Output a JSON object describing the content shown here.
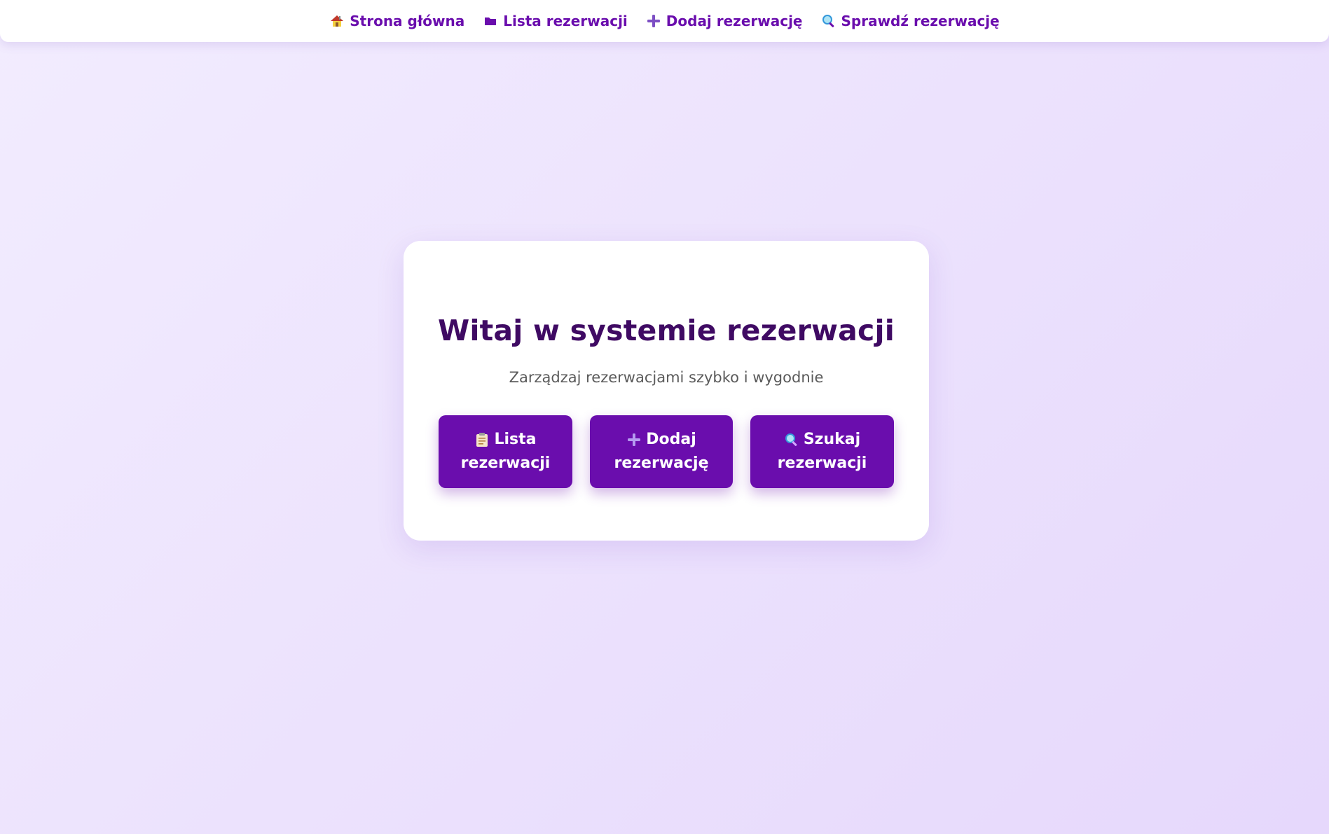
{
  "nav": {
    "items": [
      {
        "icon": "house-icon",
        "label": "Strona główna"
      },
      {
        "icon": "folder-icon",
        "label": "Lista rezerwacji"
      },
      {
        "icon": "plus-icon",
        "label": "Dodaj rezerwację"
      },
      {
        "icon": "magnifier-icon",
        "label": "Sprawdź rezerwację"
      }
    ]
  },
  "hero": {
    "title": "Witaj w systemie rezerwacji",
    "subtitle": "Zarządzaj rezerwacjami szybko i wygodnie",
    "buttons": [
      {
        "icon": "clipboard-icon",
        "line1": "Lista",
        "line2": "rezerwacji"
      },
      {
        "icon": "plus-icon",
        "line1": "Dodaj",
        "line2": "rezerwację"
      },
      {
        "icon": "magnifier-icon",
        "line1": "Szukaj",
        "line2": "rezerwacji"
      }
    ]
  },
  "colors": {
    "accent": "#6a0dad",
    "title": "#3f0a63",
    "subtitle": "#5a5a5a",
    "background": "#ece2fd",
    "card": "#ffffff"
  }
}
